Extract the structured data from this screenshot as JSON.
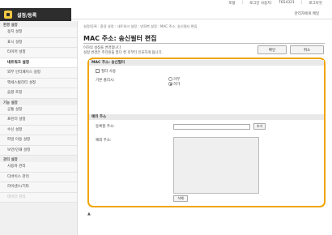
{
  "header": {
    "app_title": "설정/등록",
    "util_links": [
      "포털",
      "로그인 사용자:",
      "7654321",
      "로그아웃"
    ],
    "mail_link": "관리자에게 메일"
  },
  "sidebar": {
    "sections": [
      {
        "label": "환경 설정",
        "items": [
          "용지 설정",
          "표시 설정",
          "타이머 설정",
          "네트워크 설정",
          "외부 인터페이스 설정",
          "액세스빌리티 설정",
          "음향 조정"
        ]
      },
      {
        "label": "기능 설정",
        "items": [
          "공통 설정",
          "프린터 설정",
          "수신 설정",
          "파일 이용 설정",
          "보안/인쇄 설정"
        ]
      },
      {
        "label": "관리 설정",
        "items": [
          "사용자 관리",
          "디바이스 관리",
          "라이센스/기타",
          "데이터 관리"
        ]
      }
    ],
    "active_item": "네트워크 설정"
  },
  "main": {
    "breadcrumb": "설정/등록 : 환경 설정 : 네트워크 설정 : 방화벽 설정 : MAC 주소: 송신필터 편집",
    "page_title": "MAC 주소: 송신필터 편집",
    "message_line1": "이하의 설정을 변경합니다",
    "message_line2": "설정 변경은 주전원을 껐다 켠 후부터 유효하게 됩니다.",
    "ok_label": "확인",
    "cancel_label": "취소",
    "send_filter": {
      "section_label": "MAC 주소: 송신필터",
      "use_filter_label": "필터 사용",
      "use_filter_checked": false,
      "default_policy_label": "기본 폴리시:",
      "policy_options": [
        "거부",
        "허가"
      ],
      "policy_selected": "허가"
    },
    "exception": {
      "section_label": "예외 주소",
      "register_label": "등록할 주소:",
      "register_value": "",
      "add_label": "추가",
      "addresses_label": "예외 주소:",
      "delete_label": "삭제"
    },
    "top_link": "▲"
  }
}
